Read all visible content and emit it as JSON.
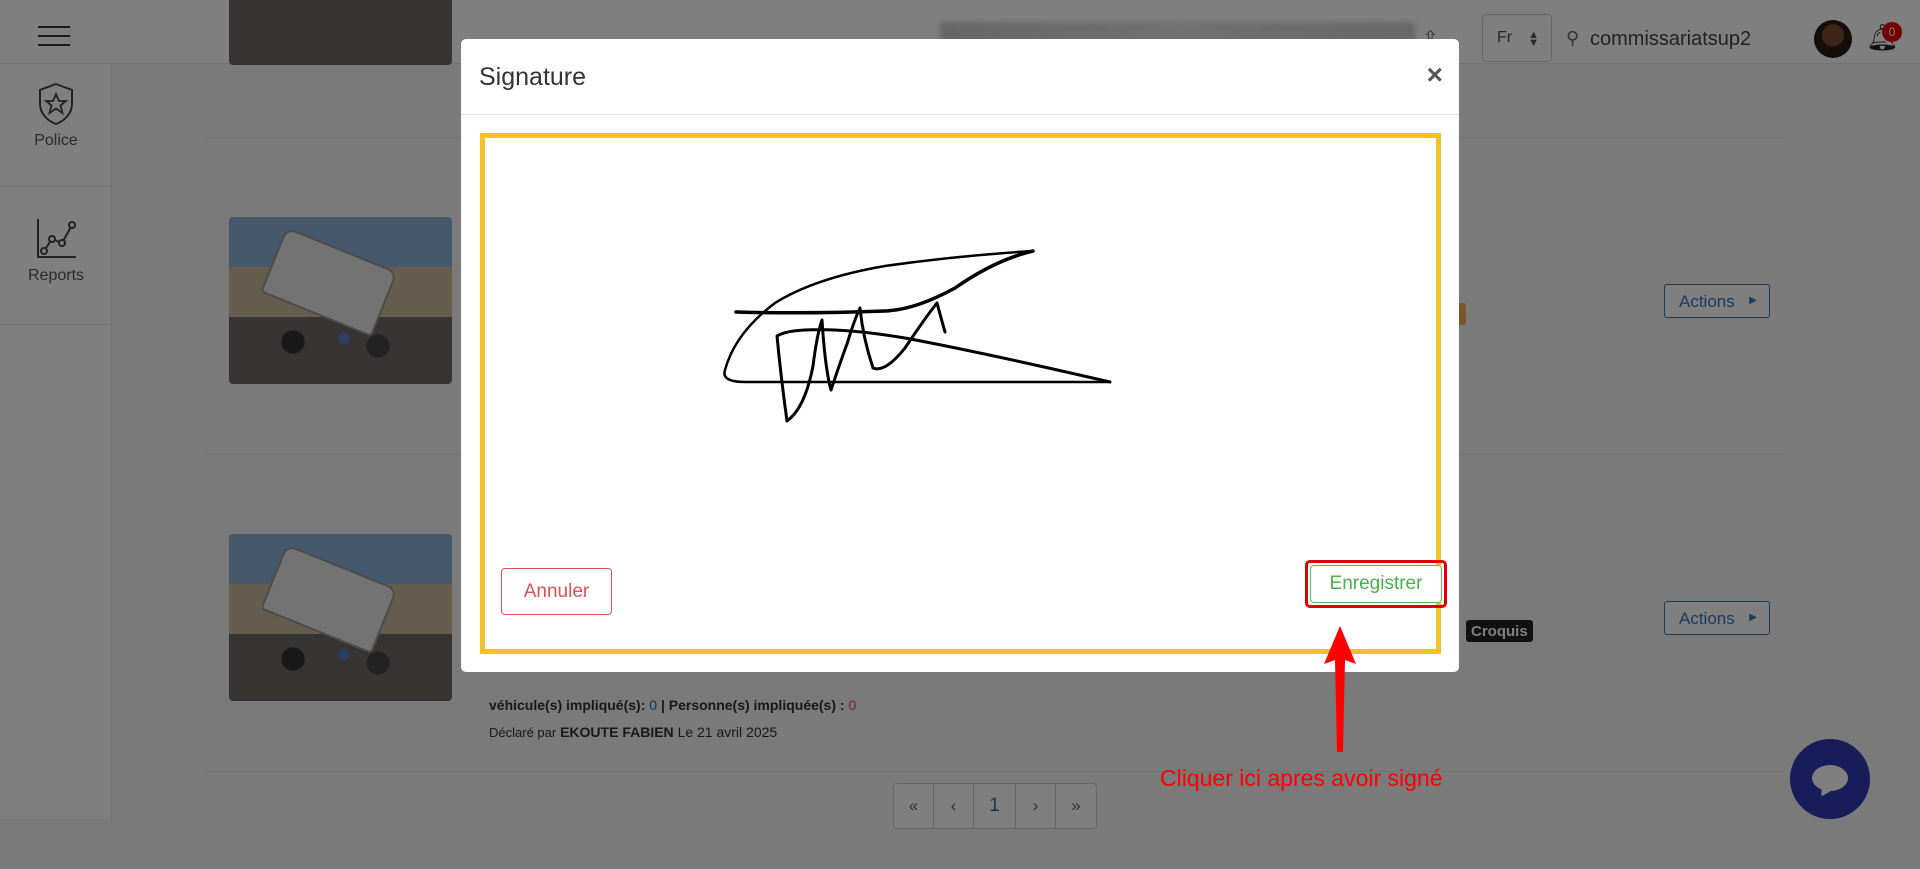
{
  "header": {
    "language": "Fr",
    "username": "commissariatsup2",
    "notification_count": "0"
  },
  "sidebar": {
    "items": [
      {
        "label": "Police",
        "icon": "police-badge-icon"
      },
      {
        "label": "Reports",
        "icon": "chart-icon"
      }
    ]
  },
  "list": {
    "rows": [
      {
        "actions_label": "Actions"
      },
      {
        "actions_label": "Actions",
        "tag": "Croquis"
      }
    ],
    "footer": {
      "vehicles_label": "véhicule(s) impliqué(s):",
      "vehicles_count": "0",
      "persons_label": "| Personne(s) impliquée(s) :",
      "persons_count": "0",
      "declared_prefix": "Déclaré par",
      "declared_by": "EKOUTE FABIEN",
      "declared_date": "Le 21 avril 2025"
    }
  },
  "pagination": {
    "first": "«",
    "prev": "‹",
    "current": "1",
    "next": "›",
    "last": "»"
  },
  "modal": {
    "title": "Signature",
    "close": "×",
    "cancel_label": "Annuler",
    "save_label": "Enregistrer"
  },
  "annotation": {
    "text": "Cliquer ici apres avoir signé",
    "color": "#ff0000"
  },
  "colors": {
    "frame": "#f3c12a",
    "primary": "#337ab7",
    "danger": "#d9534f",
    "success": "#5cb85c"
  }
}
